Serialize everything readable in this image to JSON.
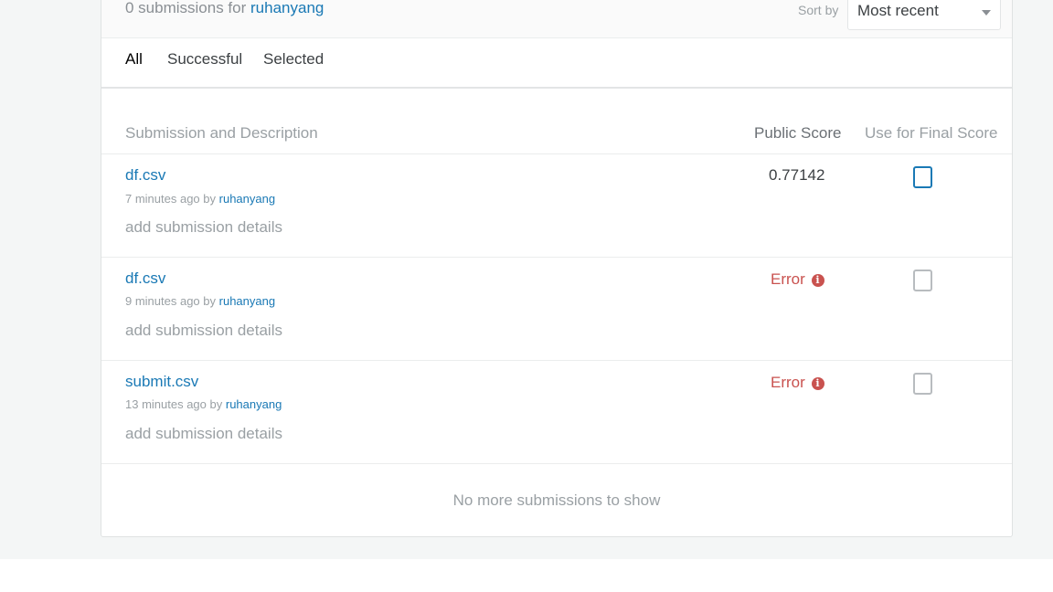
{
  "header": {
    "count_prefix": "0 submissions for",
    "username": "ruhanyang",
    "sort_label": "Sort by",
    "sort_value": "Most recent"
  },
  "tabs": [
    {
      "label": "All",
      "active": true
    },
    {
      "label": "Successful",
      "active": false
    },
    {
      "label": "Selected",
      "active": false
    }
  ],
  "table": {
    "columns": [
      "Submission and Description",
      "Public Score",
      "Use for Final Score"
    ],
    "rows": [
      {
        "file": "df.csv",
        "time": "7 minutes ago by",
        "author": "ruhanyang",
        "details": "add submission details",
        "score": "0.77142",
        "status": "ok",
        "checked": false
      },
      {
        "file": "df.csv",
        "time": "9 minutes ago by",
        "author": "ruhanyang",
        "details": "add submission details",
        "score": "Error",
        "status": "error",
        "checked": false
      },
      {
        "file": "submit.csv",
        "time": "13 minutes ago by",
        "author": "ruhanyang",
        "details": "add submission details",
        "score": "Error",
        "status": "error",
        "checked": false
      }
    ]
  },
  "footer": {
    "message": "No more submissions to show"
  },
  "colors": {
    "link": "#1a79b5",
    "error": "#c9524f",
    "muted": "#9aa0a4"
  },
  "icons": {
    "error_info": "info-circle-icon",
    "dropdown": "chevron-down-icon"
  }
}
